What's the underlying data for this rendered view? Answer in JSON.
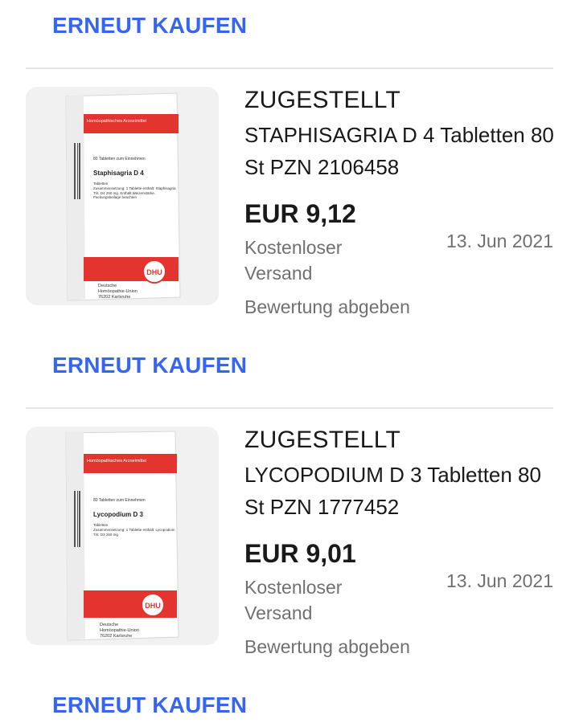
{
  "actions": {
    "buy_again_label": "ERNEUT KAUFEN"
  },
  "orders": [
    {
      "status": "ZUGESTELLT",
      "title": "STAPHISAGRIA D 4 Tabletten 80 St PZN 2106458",
      "price": "EUR 9,12",
      "shipping": "Kostenloser Versand",
      "date": "13. Jun 2021",
      "review_label": "Bewertung abgeben",
      "image": {
        "band_text": "Homöopathisches Arzneimittel",
        "count_text": "80 Tabletten zum Einnehmen",
        "product_name": "Staphisagria D 4",
        "form_text": "Tabletten",
        "composition": "Zusammensetzung: 1 Tablette enthält: Staphisagria Trit. D4 250 mg. Enthält Weizenstärke. Packungsbeilage beachten",
        "brand": "DHU",
        "maker_line1": "Deutsche",
        "maker_line2": "Homöopathie-Union",
        "maker_line3": "76202 Karlsruhe"
      }
    },
    {
      "status": "ZUGESTELLT",
      "title": "LYCOPODIUM D 3 Tabletten 80 St PZN 1777452",
      "price": "EUR 9,01",
      "shipping": "Kostenloser Versand",
      "date": "13. Jun 2021",
      "review_label": "Bewertung abgeben",
      "image": {
        "band_text": "Homöopathisches Arzneimittel",
        "count_text": "80 Tabletten zum Einnehmen",
        "product_name": "Lycopodium D 3",
        "form_text": "Tabletten",
        "composition": "Zusammensetzung: 1 Tablette enthält: Lycopodium Trit. D3 250 mg",
        "brand": "DHU",
        "maker_line1": "Deutsche",
        "maker_line2": "Homöopathie-Union",
        "maker_line3": "76202 Karlsruhe"
      }
    }
  ],
  "colors": {
    "link_blue": "#3665f3",
    "text_dark": "#191919",
    "text_muted": "#707070",
    "divider": "#e5e5e5",
    "thumb_bg": "#f1f1f1",
    "box_red": "#e3342f"
  }
}
